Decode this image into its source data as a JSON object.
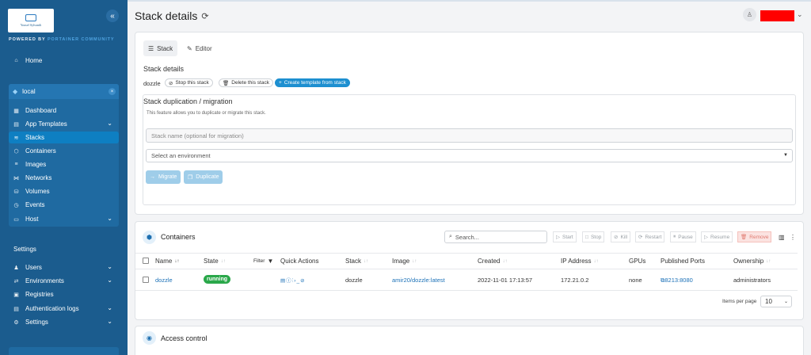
{
  "sidebar": {
    "logo_text": "Yousef Sylvanili",
    "powered_prefix": "POWERED BY",
    "powered_brand": "PORTAINER COMMUNITY",
    "home": "Home",
    "environment": "local",
    "env_items": [
      {
        "label": "Dashboard",
        "icon": "dashboard-icon"
      },
      {
        "label": "App Templates",
        "icon": "templates-icon"
      },
      {
        "label": "Stacks",
        "icon": "stacks-icon"
      },
      {
        "label": "Containers",
        "icon": "containers-icon"
      },
      {
        "label": "Images",
        "icon": "images-icon"
      },
      {
        "label": "Networks",
        "icon": "networks-icon"
      },
      {
        "label": "Volumes",
        "icon": "volumes-icon"
      },
      {
        "label": "Events",
        "icon": "events-icon"
      },
      {
        "label": "Host",
        "icon": "host-icon"
      }
    ],
    "settings_title": "Settings",
    "settings_items": [
      {
        "label": "Users",
        "icon": "users-icon"
      },
      {
        "label": "Environments",
        "icon": "environments-icon"
      },
      {
        "label": "Registries",
        "icon": "registries-icon"
      },
      {
        "label": "Authentication logs",
        "icon": "auth-logs-icon"
      },
      {
        "label": "Settings",
        "icon": "settings-icon"
      }
    ]
  },
  "header": {
    "title": "Stack details"
  },
  "stack_card": {
    "tabs": [
      "Stack",
      "Editor"
    ],
    "details_title": "Stack details",
    "stack_name": "dozzle",
    "stop_label": "Stop this stack",
    "delete_label": "Delete this stack",
    "template_label": "Create template from stack",
    "dup_title": "Stack duplication / migration",
    "dup_desc": "This feature allows you to duplicate or migrate this stack.",
    "name_placeholder": "Stack name (optional for migration)",
    "env_placeholder": "Select an environment",
    "migrate_label": "Migrate",
    "duplicate_label": "Duplicate"
  },
  "containers": {
    "title": "Containers",
    "search_placeholder": "Search...",
    "toolbar": {
      "start": "Start",
      "stop": "Stop",
      "kill": "Kill",
      "restart": "Restart",
      "pause": "Pause",
      "resume": "Resume",
      "remove": "Remove"
    },
    "columns": {
      "name": "Name",
      "state": "State",
      "filter": "Filter",
      "quick_actions": "Quick Actions",
      "stack": "Stack",
      "image": "Image",
      "created": "Created",
      "ip": "IP Address",
      "gpus": "GPUs",
      "ports": "Published Ports",
      "ownership": "Ownership"
    },
    "rows": [
      {
        "name": "dozzle",
        "state": "running",
        "stack": "dozzle",
        "image": "amir20/dozzle:latest",
        "created": "2022-11-01 17:13:57",
        "ip": "172.21.0.2",
        "gpus": "none",
        "ports": "8213:8080",
        "ownership": "administrators"
      }
    ],
    "items_per_page_label": "Items per page",
    "items_per_page": "10"
  },
  "access_control": {
    "title": "Access control"
  },
  "colors": {
    "sidebar": "#1b5c8e",
    "accent": "#1d8fd0",
    "running": "#2aa84a",
    "redacted": "#ff0000"
  }
}
